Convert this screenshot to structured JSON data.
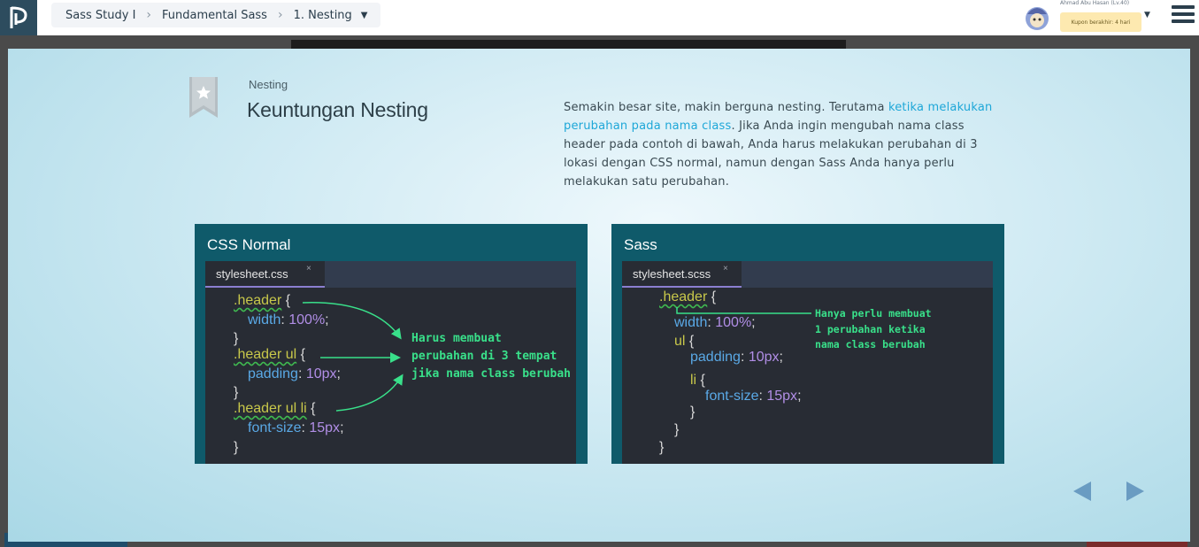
{
  "breadcrumb": {
    "items": [
      "Sass Study I",
      "Fundamental Sass",
      "1. Nesting"
    ]
  },
  "user": {
    "name": "Ahmad Abu Hasan (Lv.40)",
    "coupon": "Kupon berakhir: 4 hari"
  },
  "slide": {
    "subtitle": "Nesting",
    "title": "Keuntungan Nesting",
    "description_parts": [
      "Semakin besar site, makin berguna nesting. Terutama ",
      "ketika melakukan perubahan pada nama class",
      ". Jika Anda ingin mengubah nama class header pada contoh di bawah, Anda harus melakukan perubahan di 3 lokasi dengan CSS normal, namun dengan Sass Anda hanya perlu melakukan satu perubahan."
    ],
    "left_panel": {
      "title": "CSS Normal",
      "tab": "stylesheet.css",
      "tab_close": "×",
      "code": [
        {
          "sel": ".header",
          "rest": " {"
        },
        {
          "prop": "width",
          "val": "100%",
          "end": ";"
        },
        {
          "pun": "}"
        },
        {
          "sel": ".header ul",
          "rest": " {"
        },
        {
          "prop": "padding",
          "val": "10px",
          "end": ";"
        },
        {
          "pun": "}"
        },
        {
          "sel": ".header ul li",
          "rest": " {"
        },
        {
          "prop": "font-size",
          "val": "15px",
          "end": ";"
        },
        {
          "pun": "}"
        }
      ],
      "note": [
        "Harus membuat",
        "perubahan di 3 tempat",
        "jika nama class berubah"
      ]
    },
    "right_panel": {
      "title": "Sass",
      "tab": "stylesheet.scss",
      "tab_close": "×",
      "code": [
        {
          "sel": ".header",
          "rest": " {"
        },
        {
          "prop": "width",
          "val": "100%",
          "end": ";"
        },
        {
          "sel2": "ul",
          "rest": " {"
        },
        {
          "prop": "padding",
          "val": "10px",
          "end": ";"
        },
        {
          "sel2": "li",
          "rest": " {"
        },
        {
          "prop": "font-size",
          "val": "15px",
          "end": ";"
        },
        {
          "pun": "}"
        },
        {
          "pun": "}"
        },
        {
          "pun": "}"
        }
      ],
      "note": [
        "Hanya perlu membuat",
        "1 perubahan ketika",
        "nama class berubah"
      ]
    }
  },
  "colors": {
    "accent": "#1ea7d8",
    "panel": "#0f5a6a",
    "note": "#39e08a"
  }
}
